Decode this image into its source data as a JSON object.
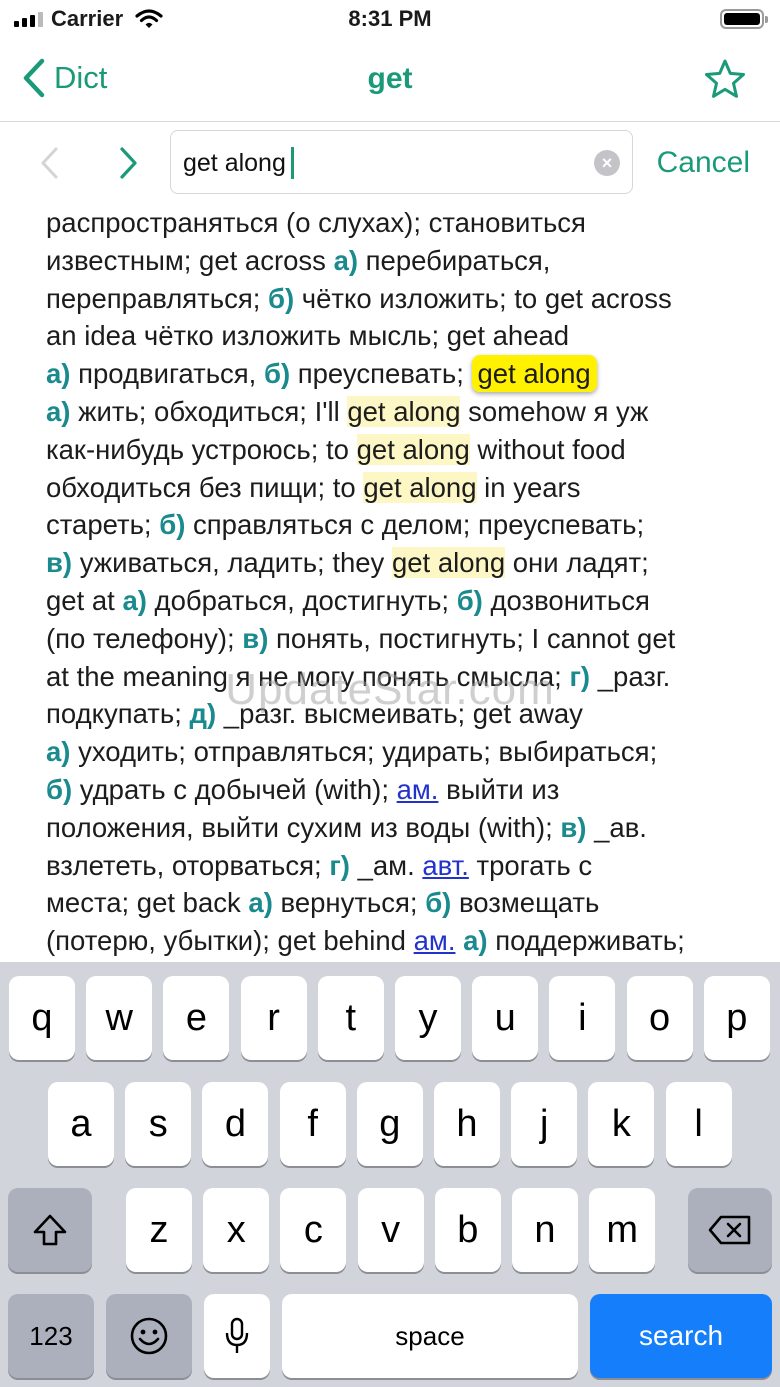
{
  "status_bar": {
    "carrier": "Carrier",
    "time": "8:31 PM"
  },
  "nav": {
    "back_label": "Dict",
    "title": "get"
  },
  "search": {
    "value": "get along",
    "cancel_label": "Cancel"
  },
  "article": {
    "lines": [
      [
        {
          "t": "распространяться (о слухах); становиться"
        }
      ],
      [
        {
          "t": "известным; get across "
        },
        {
          "t": "а)",
          "c": "b"
        },
        {
          "t": " перебираться,"
        }
      ],
      [
        {
          "t": "переправляться; "
        },
        {
          "t": "б)",
          "c": "b"
        },
        {
          "t": " чётко изложить; to get across"
        }
      ],
      [
        {
          "t": "an idea чётко изложить мысль; get ahead"
        }
      ],
      [
        {
          "t": "а)",
          "c": "b"
        },
        {
          "t": " продвигаться, "
        },
        {
          "t": "б)",
          "c": "b"
        },
        {
          "t": " преуспевать; "
        },
        {
          "t": "get along",
          "c": "hl-cur"
        }
      ],
      [
        {
          "t": "а)",
          "c": "b"
        },
        {
          "t": " жить; обходиться; I'll "
        },
        {
          "t": "get along",
          "c": "hl"
        },
        {
          "t": " somehow я уж"
        }
      ],
      [
        {
          "t": "как-нибудь устроюсь; to "
        },
        {
          "t": "get along",
          "c": "hl"
        },
        {
          "t": " without food"
        }
      ],
      [
        {
          "t": "обходиться без пищи; to "
        },
        {
          "t": "get along",
          "c": "hl"
        },
        {
          "t": " in years"
        }
      ],
      [
        {
          "t": "стареть; "
        },
        {
          "t": "б)",
          "c": "b"
        },
        {
          "t": " справляться с делом; преуспевать;"
        }
      ],
      [
        {
          "t": "в)",
          "c": "b"
        },
        {
          "t": " уживаться, ладить; they "
        },
        {
          "t": "get along",
          "c": "hl"
        },
        {
          "t": " они ладят;"
        }
      ],
      [
        {
          "t": "get at "
        },
        {
          "t": "а)",
          "c": "b"
        },
        {
          "t": " добраться, достигнуть; "
        },
        {
          "t": "б)",
          "c": "b"
        },
        {
          "t": " дозвониться"
        }
      ],
      [
        {
          "t": "(по телефону); "
        },
        {
          "t": "в)",
          "c": "b"
        },
        {
          "t": " понять, постигнуть; I cannot get"
        }
      ],
      [
        {
          "t": "at the meaning я не могу понять смысла; "
        },
        {
          "t": "г)",
          "c": "b"
        },
        {
          "t": " _разг."
        }
      ],
      [
        {
          "t": "подкупать; "
        },
        {
          "t": "д)",
          "c": "b"
        },
        {
          "t": " _разг. высмеивать; get away"
        }
      ],
      [
        {
          "t": "а)",
          "c": "b"
        },
        {
          "t": " уходить; отправляться; удирать; выбираться;"
        }
      ],
      [
        {
          "t": "б)",
          "c": "b"
        },
        {
          "t": " удрать с добычей (with); "
        },
        {
          "t": "ам.",
          "c": "lnk"
        },
        {
          "t": " выйти из"
        }
      ],
      [
        {
          "t": "положения, выйти сухим из воды (with); "
        },
        {
          "t": "в)",
          "c": "b"
        },
        {
          "t": " _ав."
        }
      ],
      [
        {
          "t": "взлететь, оторваться; "
        },
        {
          "t": "г)",
          "c": "b"
        },
        {
          "t": " _ам. "
        },
        {
          "t": "авт.",
          "c": "lnk"
        },
        {
          "t": " трогать с"
        }
      ],
      [
        {
          "t": "места; get back "
        },
        {
          "t": "а)",
          "c": "b"
        },
        {
          "t": " вернуться; "
        },
        {
          "t": "б)",
          "c": "b"
        },
        {
          "t": " возмещать"
        }
      ],
      [
        {
          "t": "(потерю, убытки); get behind "
        },
        {
          "t": "ам.",
          "c": "lnk"
        },
        {
          "t": " "
        },
        {
          "t": "а)",
          "c": "b"
        },
        {
          "t": " поддерживать;"
        }
      ]
    ]
  },
  "watermark": "UpdateStar.com",
  "keyboard": {
    "row1": [
      "q",
      "w",
      "e",
      "r",
      "t",
      "y",
      "u",
      "i",
      "o",
      "p"
    ],
    "row2": [
      "a",
      "s",
      "d",
      "f",
      "g",
      "h",
      "j",
      "k",
      "l"
    ],
    "row3": [
      "z",
      "x",
      "c",
      "v",
      "b",
      "n",
      "m"
    ],
    "numbers_label": "123",
    "space_label": "space",
    "search_label": "search"
  },
  "colors": {
    "accent": "#1a9a78",
    "bold_marker": "#1a8a8e",
    "link": "#2233cc",
    "highlight": "#fdf7c6",
    "current_highlight": "#fff100",
    "keyboard_search": "#147efb"
  }
}
